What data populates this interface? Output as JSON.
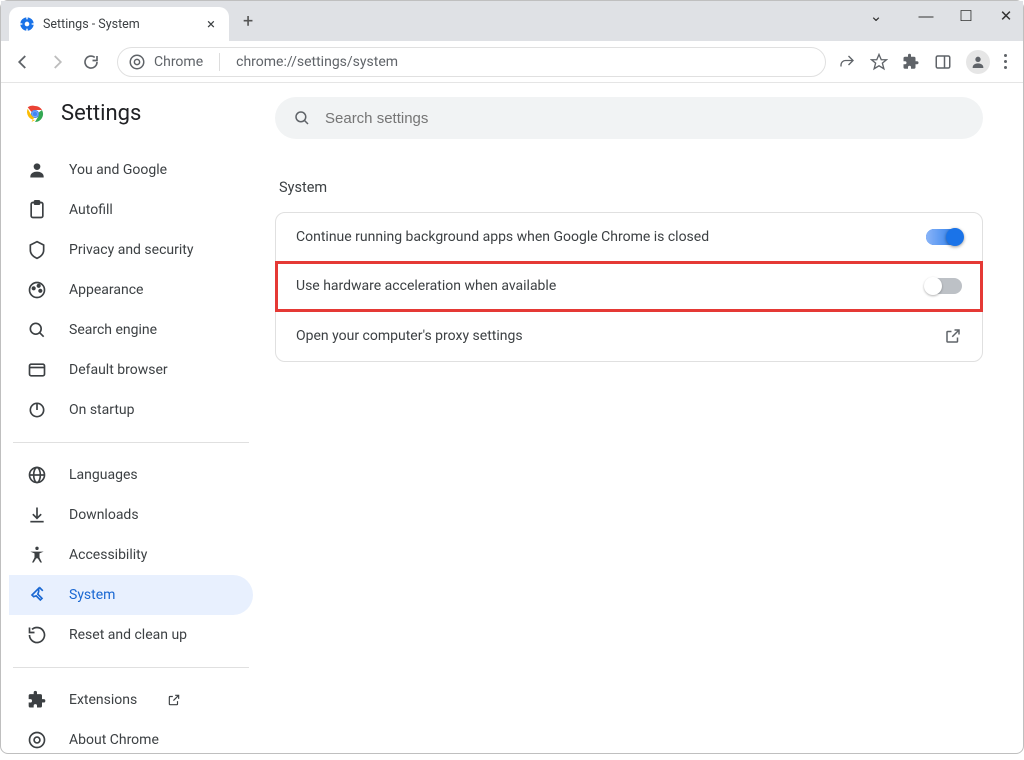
{
  "window": {
    "tab_title": "Settings - System"
  },
  "addressbar": {
    "left_label": "Chrome",
    "url": "chrome://settings/system"
  },
  "sidebar": {
    "title": "Settings",
    "groups": [
      [
        "You and Google",
        "Autofill",
        "Privacy and security",
        "Appearance",
        "Search engine",
        "Default browser",
        "On startup"
      ],
      [
        "Languages",
        "Downloads",
        "Accessibility",
        "System",
        "Reset and clean up"
      ],
      [
        "Extensions",
        "About Chrome"
      ]
    ],
    "active": "System"
  },
  "search": {
    "placeholder": "Search settings"
  },
  "section": {
    "heading": "System"
  },
  "rows": [
    {
      "label": "Continue running background apps when Google Chrome is closed",
      "control": "toggle",
      "value": true,
      "highlight": false
    },
    {
      "label": "Use hardware acceleration when available",
      "control": "toggle",
      "value": false,
      "highlight": true
    },
    {
      "label": "Open your computer's proxy settings",
      "control": "link",
      "highlight": false
    }
  ]
}
